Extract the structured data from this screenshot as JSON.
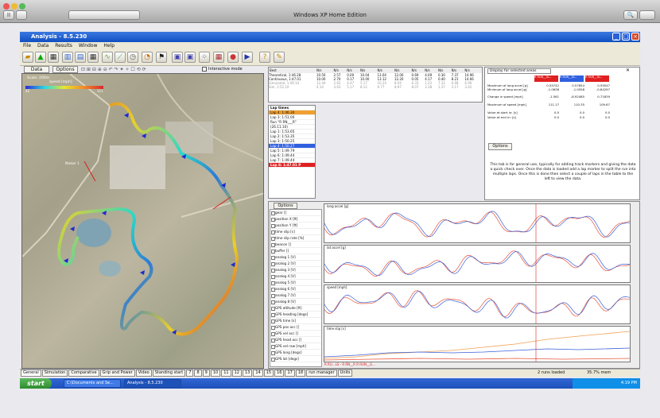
{
  "mac": {
    "title": "Windows XP Home Edition",
    "pause": "II",
    "search": "🔍"
  },
  "window": {
    "title": "Analysis - 8.5.230"
  },
  "menu": [
    "File",
    "Data",
    "Results",
    "Window",
    "Help"
  ],
  "left_tabs": {
    "data": "Data",
    "options": "Options",
    "interactive": "Interactive mode"
  },
  "map": {
    "scale": "Scale: 200m",
    "legend_label": "speed [mph]",
    "legend_min": "42",
    "legend_max": "111",
    "marker": "Marker 1"
  },
  "table": {
    "header": [
      "Best",
      "N/s",
      "N/s",
      "N/s",
      "N/s",
      "N/s",
      "N/s",
      "N/s",
      "N/s",
      "N/s",
      "N/s",
      "N/s"
    ],
    "rows": [
      [
        "Theoretical, 1:46.28",
        "10.50",
        "2.57",
        "0.00",
        "10.04",
        "13.04",
        "12.00",
        "0.69",
        "4.09",
        "0.30",
        "7.37",
        "14.96"
      ],
      [
        "Continuous, 1:47.01",
        "10.00",
        "2.70",
        "0.17",
        "10.00",
        "13.12",
        "12.20",
        "0.05",
        "4.17",
        "0.40",
        "8.21",
        "14.66"
      ],
      [
        "Simulated, 1:49.14",
        "12.44",
        "2.62",
        "4.47",
        "5.17",
        "10.24",
        "8.04",
        "6.33",
        "1.22",
        "7.32",
        "6.68",
        "6.90"
      ],
      [
        "Sim. 1:52.10",
        "4.14",
        "3.63",
        "5.17",
        "8.12",
        "6.77",
        "8.97",
        "8.07",
        "3.38",
        "1.37",
        "3.17",
        "3.42"
      ]
    ]
  },
  "laps": {
    "title": "Lap times",
    "items": [
      "Lap 4: 1:46.30",
      "Lap 3: 1:51.00",
      "Run \"R RN___R\"",
      "(26.11.10)",
      "Lap 1: 1:53.65",
      "Lap 2: 1:53.35",
      "Lap 3: 1:50.25",
      "Lap 4: 1:50.27",
      "Lap 5: 1:49.79",
      "Lap 6: 1:49.44",
      "Lap 7: 1:49.44",
      "Lap 8: 1:47.01 P"
    ]
  },
  "right_panel": {
    "title": "Display for selected areas",
    "cols": [
      "R RUN__GL..",
      "R RUN__GL..",
      "R RUN__GL.."
    ],
    "rows": [
      {
        "label": "Maximum of long accel [g]",
        "v": [
          "0.59742",
          "0.57654",
          "0.59547"
        ]
      },
      {
        "label": "Minimum of long accel [g]",
        "v": [
          "-1.0638",
          "-1.0558",
          "-0.84297"
        ]
      },
      {
        "label": "Change in speed [mph]",
        "v": [
          "-1.561",
          "-8.92485",
          "0.71839"
        ]
      },
      {
        "label": "Maximum of speed [mph]",
        "v": [
          "111.17",
          "110.35",
          "109.67"
        ]
      },
      {
        "label": "Value at start in: [s]",
        "v": [
          "0.0",
          "0.0",
          "0.0"
        ]
      },
      {
        "label": "Value at end in: [s]",
        "v": [
          "0.0",
          "0.0",
          "0.0"
        ]
      }
    ],
    "options": "Options",
    "help": "This tab is for general use, typically for adding track markers and giving the data a quick check over. Once the data is loaded add a lap marker to split the run into multiple laps. Once this is done then select a couple of laps in the table to the left to view the data."
  },
  "graphs": {
    "options": "Options",
    "channels": [
      "gear []",
      "position X [ft]",
      "position Y [ft]",
      "time slip [s]",
      "time slip rate [%]",
      "beacon []",
      "buffer []",
      "analog 1 [V]",
      "analog 2 [V]",
      "analog 3 [V]",
      "analog 4 [V]",
      "analog 5 [V]",
      "analog 6 [V]",
      "analog 7 [V]",
      "analog 8 [V]",
      "GPS altitude [ft]",
      "GPS heading [degs]",
      "GPS time [s]",
      "GPS pos acc []",
      "GPS vel acc []",
      "GPS head acc []",
      "GPS vel raw [mph]",
      "GPS long [degs]",
      "GPS lat [degs]"
    ],
    "plot_labels": [
      "long accel [g]",
      "lat accel [g]",
      "speed [mph]",
      "time slip [s]"
    ],
    "legend": "R RU...LS  - R RN__R    R RUN__G..."
  },
  "status": {
    "tabs": [
      "General",
      "Simulation",
      "Comparative",
      "Grip and Power",
      "Video",
      "Standing start",
      "7",
      "8",
      "9",
      "10",
      "11",
      "12",
      "13",
      "14",
      "15",
      "16",
      "17",
      "18",
      "run manager",
      "Units"
    ],
    "runs": "2 runs loaded",
    "mem": "35.7% mem"
  },
  "taskbar": {
    "start": "start",
    "tasks": [
      "C:\\Documents and Se...",
      "Analysis - 8.5.230"
    ],
    "time": "4:19 PM"
  },
  "colors": {
    "xp_blue": "#0f4fc2",
    "series1": "#e8553a",
    "series2": "#3a5fd8",
    "marker": "#e02020"
  }
}
